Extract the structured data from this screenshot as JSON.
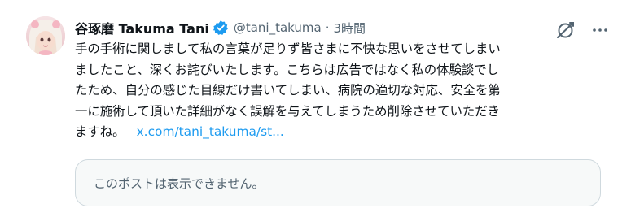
{
  "author": {
    "name": "谷琢磨 Takuma Tani",
    "handle": "@tani_takuma",
    "separator": "·",
    "time": "3時間",
    "verified": true,
    "avatar_icon": "profile-photo"
  },
  "tweet": {
    "lines": [
      "手の手術に関しまして私の言葉が足りず皆さまに不快な思いをさせてしまい",
      "ましたこと、深くお詫びいたします。こちらは広告ではなく私の体験談でし",
      "たため、自分の感じた目線だけ書いてしまい、病院の適切な対応、安全を第",
      "一に施術して頂いた詳細がなく誤解を与えてしまうため削除させていただき"
    ],
    "last_line": "ますね。",
    "link": "x.com/tani_takuma/st..."
  },
  "quote": {
    "text": "このポストは表示できません。"
  },
  "icons": {
    "grok": "grok-icon",
    "more": "more-icon",
    "verified": "verified-badge-icon"
  },
  "colors": {
    "link": "#1d9bf0",
    "muted": "#536471",
    "verified": "#1d9bf0",
    "quote_bg": "#f7f9f9",
    "quote_border": "#cfd9de"
  }
}
